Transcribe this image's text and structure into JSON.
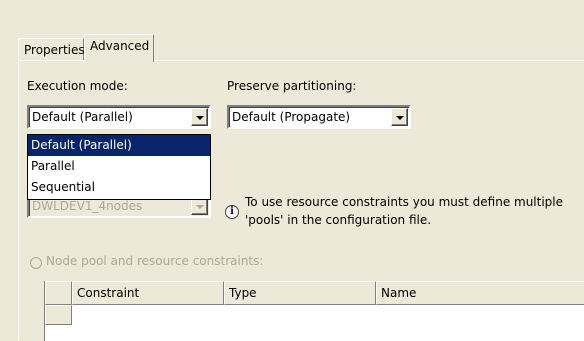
{
  "tabs": [
    {
      "label": "Properties",
      "active": false
    },
    {
      "label": "Advanced",
      "active": true
    }
  ],
  "execution_mode": {
    "label": "Execution mode:",
    "value": "Default (Parallel)",
    "options": [
      "Default (Parallel)",
      "Parallel",
      "Sequential"
    ],
    "highlighted": "Default (Parallel)"
  },
  "preserve_partitioning": {
    "label": "Preserve partitioning:",
    "value": "Default (Propagate)"
  },
  "config_file": {
    "value": "DWLDEV1_4nodes",
    "disabled": true
  },
  "info": {
    "icon": "info-icon",
    "text": "To use resource constraints you must define multiple 'pools' in the configuration file."
  },
  "node_pool": {
    "label": "Node pool and resource constraints:",
    "checked": false,
    "disabled": true
  },
  "constraints_table": {
    "columns": [
      "Constraint",
      "Type",
      "Name"
    ],
    "rows": []
  },
  "colors": {
    "background": "#ece9d8",
    "selection": "#0a246a",
    "disabled_text": "#aca899"
  }
}
